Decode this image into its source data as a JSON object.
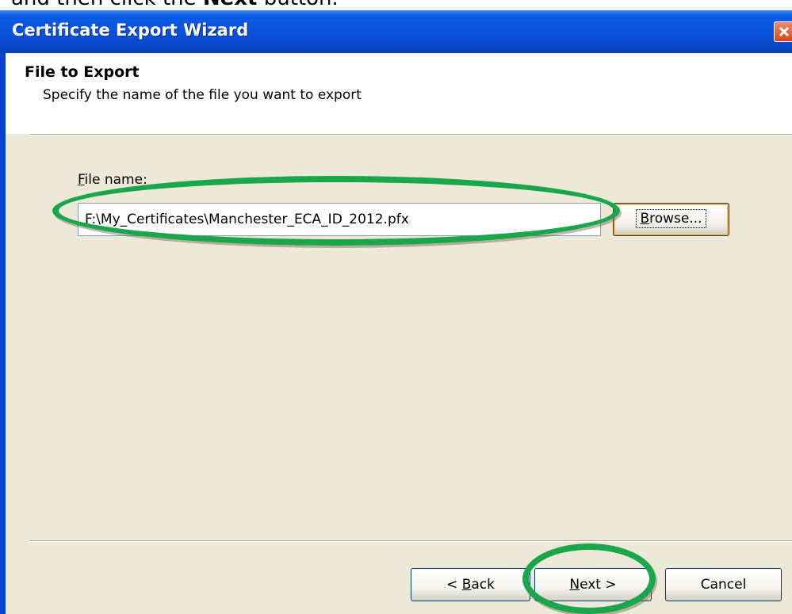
{
  "instruction": {
    "prefix": "and then click the ",
    "bold": "Next",
    "suffix": " button."
  },
  "window": {
    "title": "Certificate Export Wizard",
    "close_icon": "close-icon"
  },
  "header": {
    "title": "File to Export",
    "subtitle": "Specify the name of the file you want to export"
  },
  "file_field": {
    "label_accel": "F",
    "label_rest": "ile name:",
    "value": "F:\\My_Certificates\\Manchester_ECA_ID_2012.pfx"
  },
  "buttons": {
    "browse_accel": "B",
    "browse_rest": "rowse...",
    "back_prefix": "< ",
    "back_accel": "B",
    "back_rest": "ack",
    "next_accel": "N",
    "next_rest": "ext >",
    "cancel": "Cancel"
  },
  "colors": {
    "titlebar": "#0a52dc",
    "dialog_bg": "#ece9d8",
    "highlight": "#1aa64a"
  }
}
